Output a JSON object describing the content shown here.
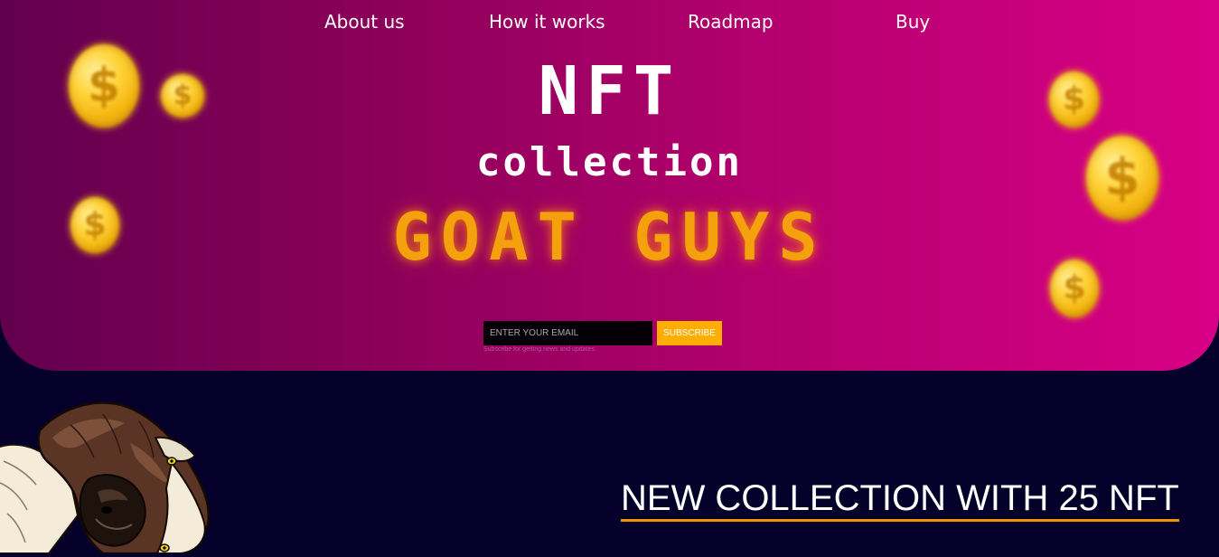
{
  "nav": {
    "items": [
      {
        "label": "About us"
      },
      {
        "label": "How it works"
      },
      {
        "label": "Roadmap"
      },
      {
        "label": "Buy"
      }
    ]
  },
  "hero": {
    "title": "NFT",
    "subtitle": "collection",
    "brand": "GOAT GUYS",
    "brand_color": "#f5a10d",
    "gradient_colors": [
      "#62004e",
      "#8a0058",
      "#b3006d",
      "#d80086"
    ]
  },
  "subscribe": {
    "email_placeholder": "ENTER YOUR EMAIL",
    "button_label": "SUBSCRIBE",
    "button_color": "#ffae00",
    "hint": "Subscribe for getting news and updates"
  },
  "coins": {
    "icon": "dollar-coin-icon",
    "symbol": "$",
    "color": "#ffd33a"
  },
  "mascot": {
    "icon": "goat-head-icon"
  },
  "section": {
    "heading": "NEW COLLECTION WITH 25 NFT",
    "underline_color": "#f39200"
  },
  "page": {
    "background_color": "#04002a"
  }
}
